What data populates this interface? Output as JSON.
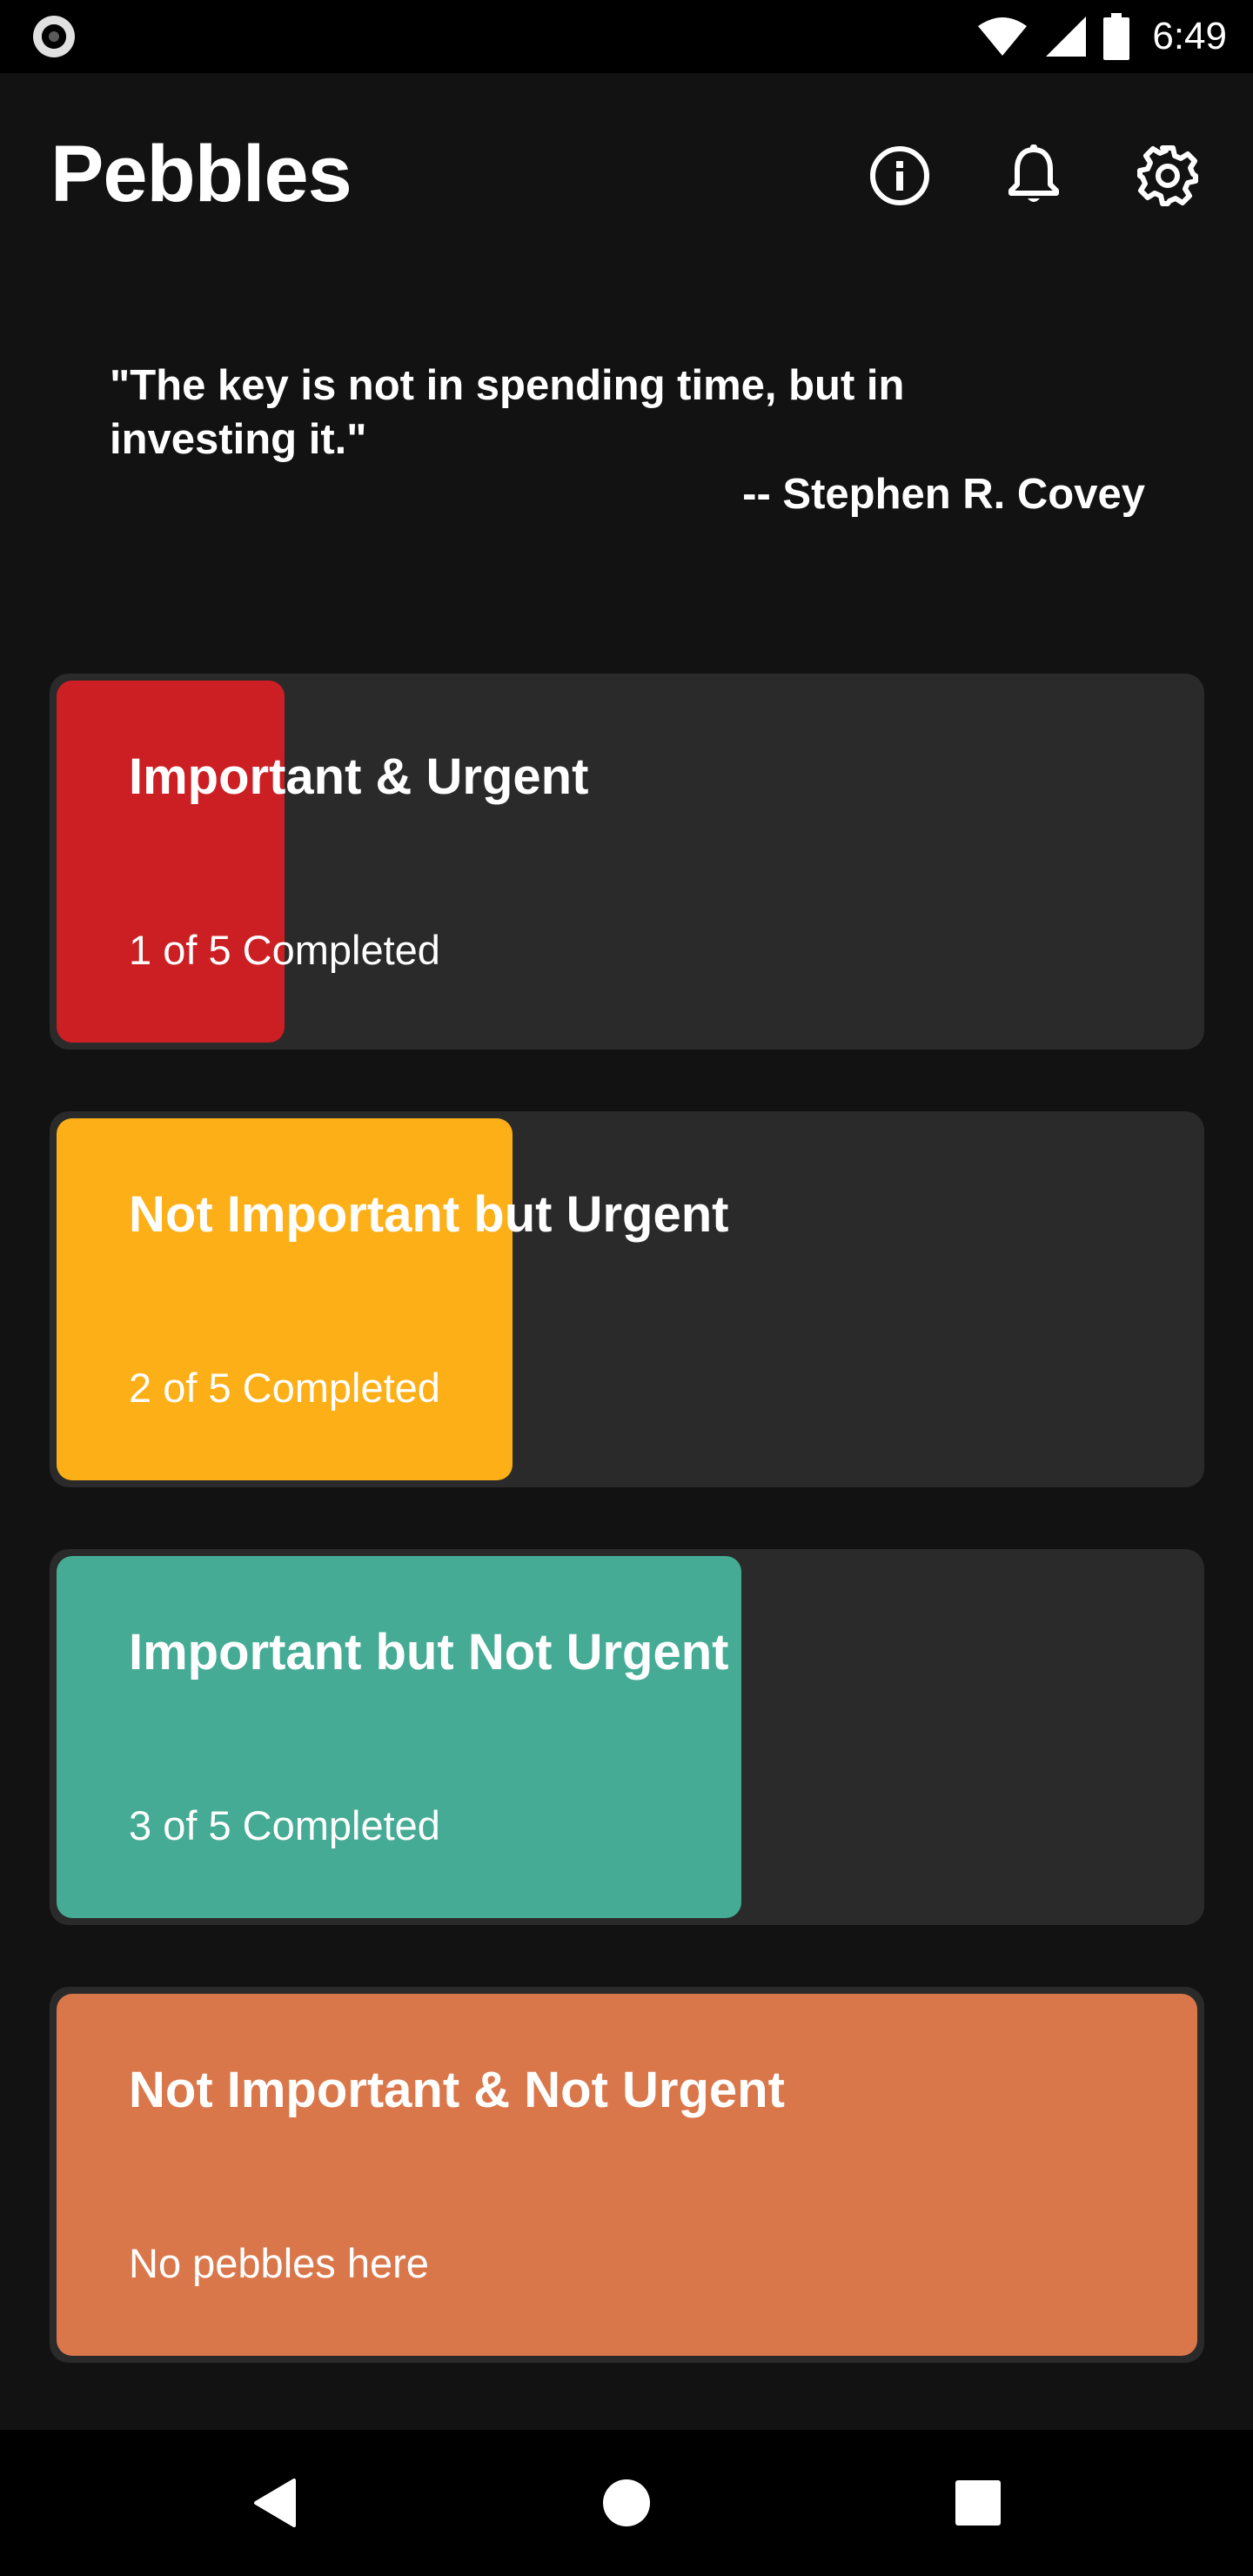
{
  "status_bar": {
    "time": "6:49",
    "icons": [
      "record-icon",
      "wifi-icon",
      "cell-signal-icon",
      "battery-icon"
    ]
  },
  "header": {
    "title": "Pebbles",
    "actions": [
      "info-icon",
      "bell-icon",
      "gear-icon"
    ]
  },
  "quote": {
    "text": "\"The key is not in spending time, but in investing it.\"",
    "author": "-- Stephen R. Covey"
  },
  "quadrants": [
    {
      "title": "Important & Urgent",
      "status": "1 of 5 Completed",
      "completed_fraction": 0.2,
      "color": "#cc1f24"
    },
    {
      "title": "Not Important but Urgent",
      "status": "2 of 5 Completed",
      "completed_fraction": 0.4,
      "color": "#fdaf17"
    },
    {
      "title": "Important but Not Urgent",
      "status": "3 of 5 Completed",
      "completed_fraction": 0.6,
      "color": "#45ab95"
    },
    {
      "title": "Not Important & Not Urgent",
      "status": "No pebbles here",
      "completed_fraction": 1.0,
      "color": "#d9774b"
    }
  ],
  "card_track_color": "#2a2a2a",
  "background_color": "#121212",
  "nav_bar": {
    "buttons": [
      "back-icon",
      "home-icon",
      "recents-icon"
    ]
  }
}
